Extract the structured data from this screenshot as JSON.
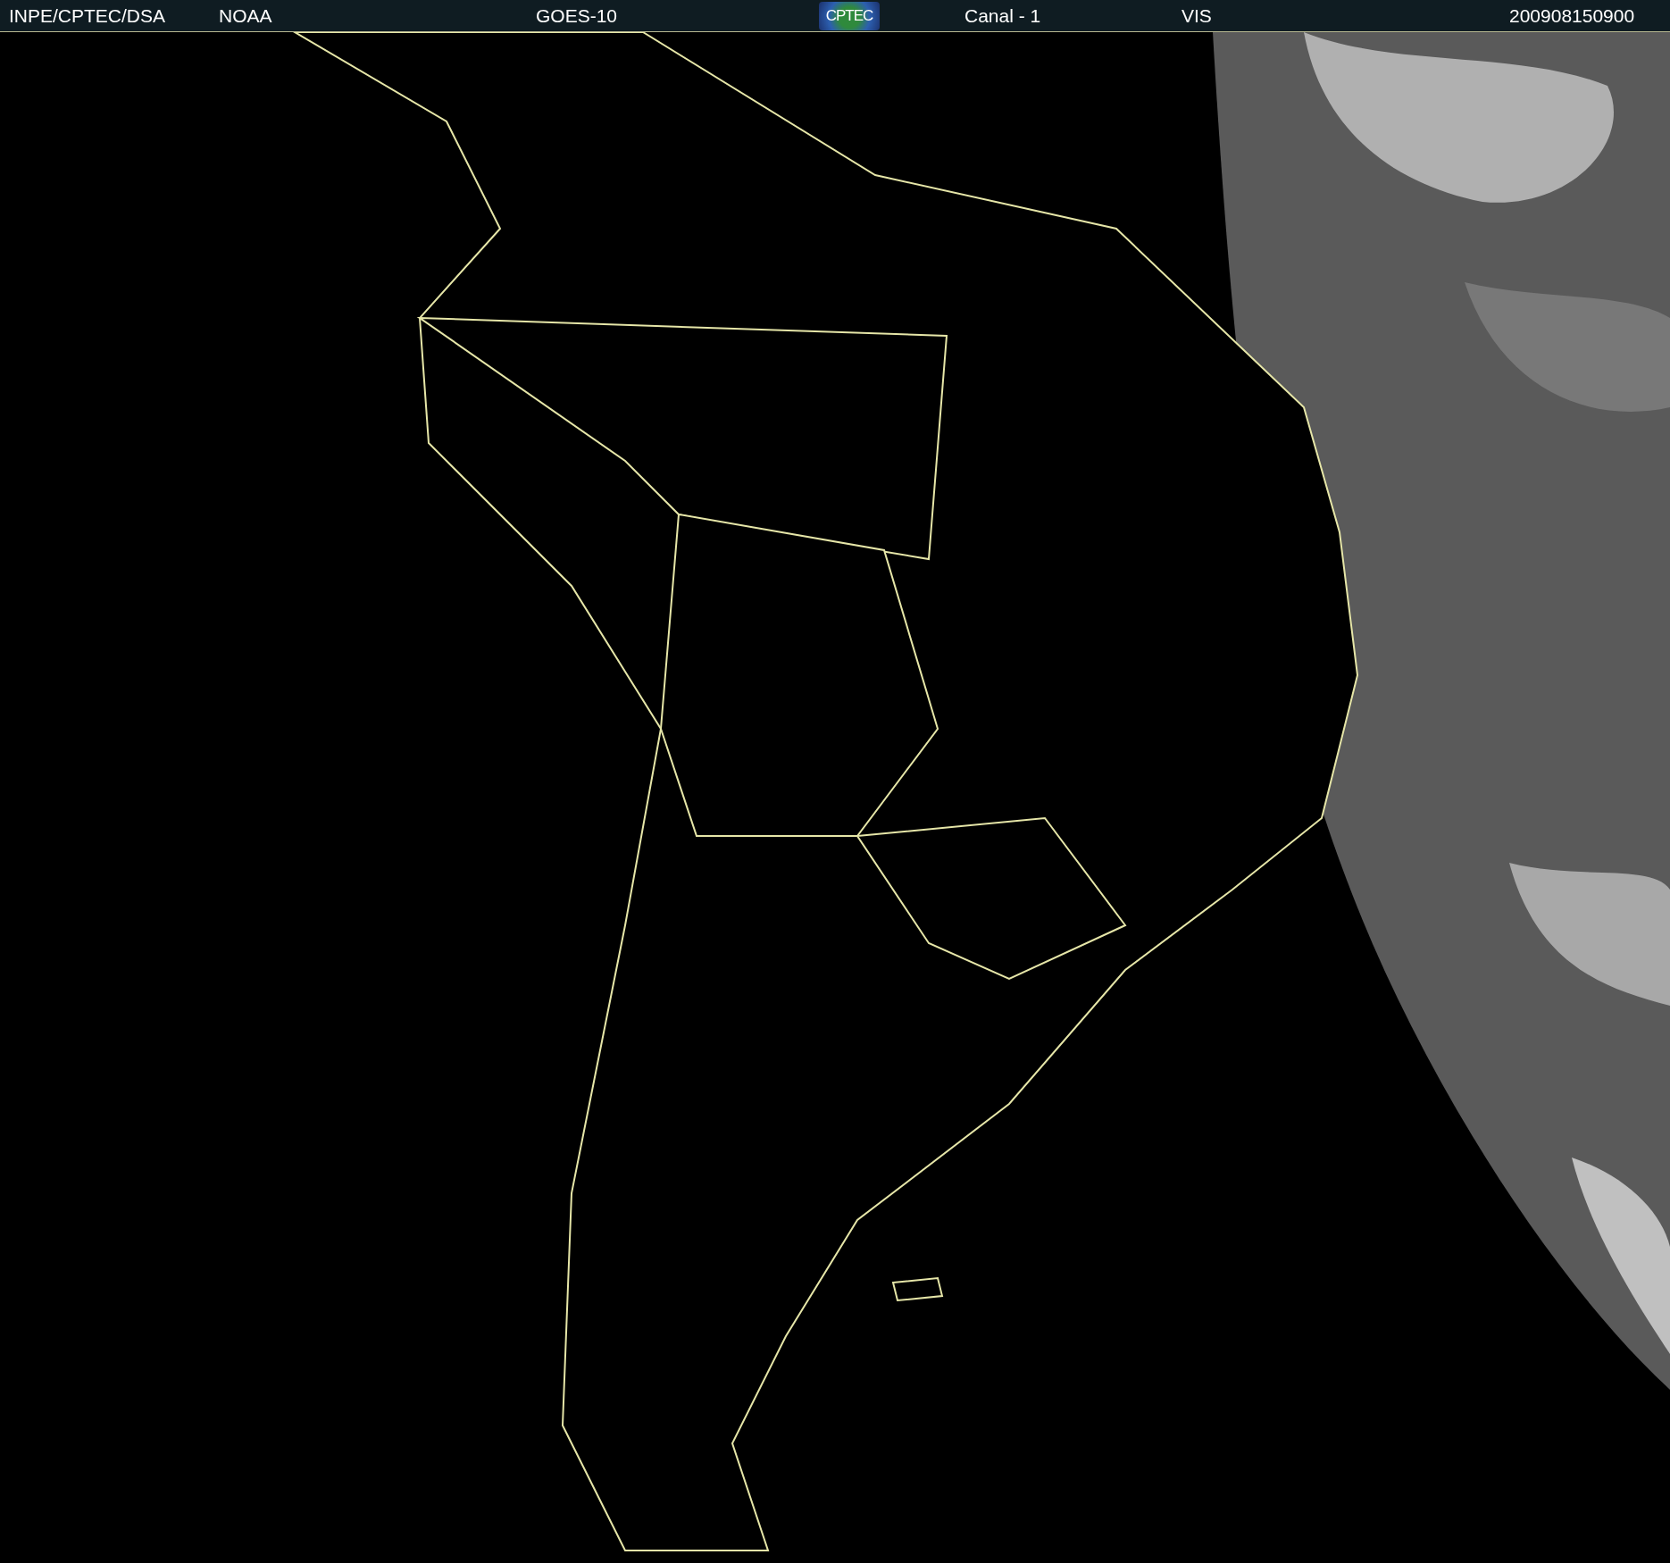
{
  "header": {
    "items": [
      {
        "kind": "text",
        "text": "INPE/CPTEC/DSA"
      },
      {
        "kind": "text",
        "text": "NOAA"
      },
      {
        "kind": "text",
        "text": "GOES-10"
      },
      {
        "kind": "logo",
        "text": "CPTEC"
      },
      {
        "kind": "text",
        "text": "Canal - 1"
      },
      {
        "kind": "text",
        "text": "VIS"
      },
      {
        "kind": "text",
        "text": "200908150900"
      }
    ]
  }
}
